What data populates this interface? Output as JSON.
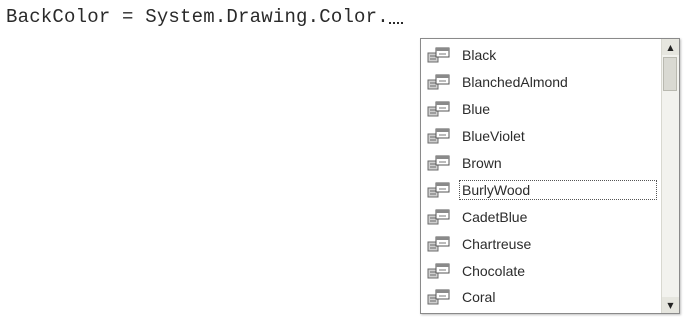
{
  "editor": {
    "code_text": "BackColor = System.Drawing.Color."
  },
  "intellisense": {
    "items": [
      {
        "label": "Black",
        "icon": "property-icon"
      },
      {
        "label": "BlanchedAlmond",
        "icon": "property-icon"
      },
      {
        "label": "Blue",
        "icon": "property-icon"
      },
      {
        "label": "BlueViolet",
        "icon": "property-icon"
      },
      {
        "label": "Brown",
        "icon": "property-icon"
      },
      {
        "label": "BurlyWood",
        "icon": "property-icon"
      },
      {
        "label": "CadetBlue",
        "icon": "property-icon"
      },
      {
        "label": "Chartreuse",
        "icon": "property-icon"
      },
      {
        "label": "Chocolate",
        "icon": "property-icon"
      },
      {
        "label": "Coral",
        "icon": "property-icon"
      }
    ],
    "selected": "BurlyWood",
    "scrollbar": {
      "up_icon": "arrow-up-icon",
      "down_icon": "arrow-down-icon"
    }
  }
}
